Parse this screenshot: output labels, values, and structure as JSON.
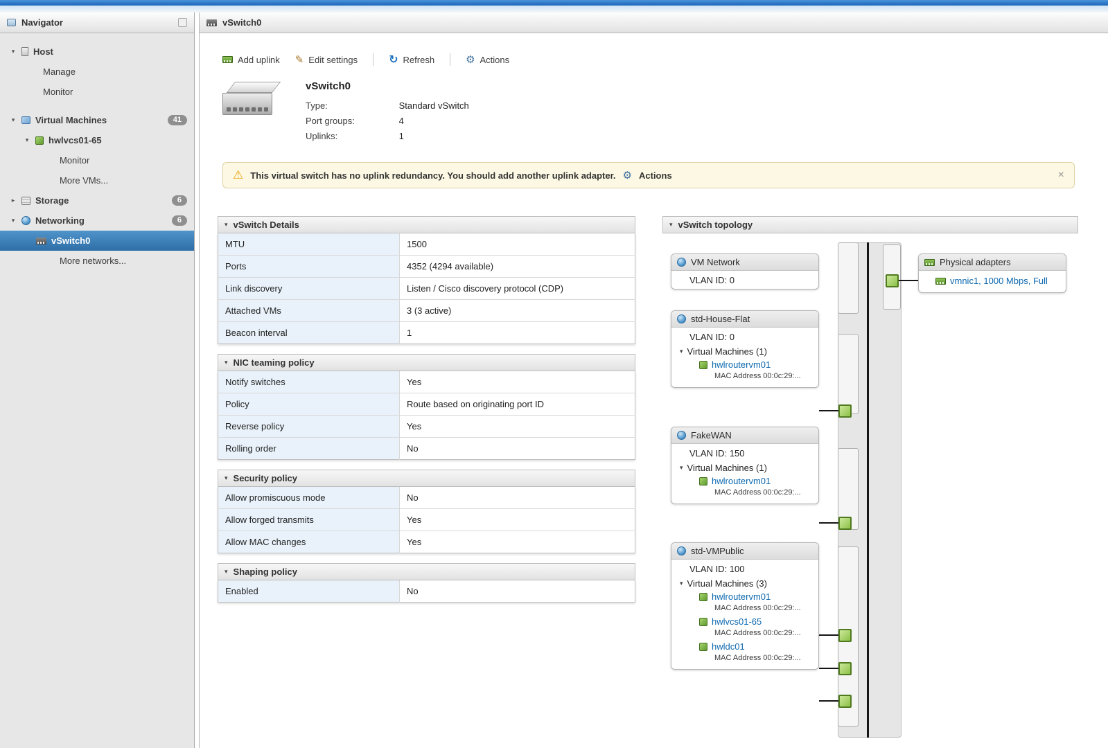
{
  "theme": {
    "topbar_blue": "#2374c8",
    "selection_blue": "#3377ad",
    "link_blue": "#0e69b0",
    "warning_bg": "#fcf8e3",
    "port_green": "#8cc148",
    "label_cell_blue": "#e9f2fa"
  },
  "navigator": {
    "title": "Navigator",
    "items": [
      {
        "label": "Host"
      },
      {
        "label": "Manage"
      },
      {
        "label": "Monitor"
      },
      {
        "label": "Virtual Machines",
        "badge": "41"
      },
      {
        "label": "hwlvcs01-65"
      },
      {
        "label": "Monitor"
      },
      {
        "label": "More VMs..."
      },
      {
        "label": "Storage",
        "badge": "6"
      },
      {
        "label": "Networking",
        "badge": "6"
      },
      {
        "label": "vSwitch0"
      },
      {
        "label": "More networks..."
      }
    ]
  },
  "main": {
    "title": "vSwitch0",
    "toolbar": {
      "add_uplink": "Add uplink",
      "edit_settings": "Edit settings",
      "refresh": "Refresh",
      "actions": "Actions"
    },
    "summary": {
      "name": "vSwitch0",
      "rows": [
        {
          "label": "Type:",
          "value": "Standard vSwitch"
        },
        {
          "label": "Port groups:",
          "value": "4"
        },
        {
          "label": "Uplinks:",
          "value": "1"
        }
      ]
    },
    "warning": {
      "text": "This virtual switch has no uplink redundancy. You should add another uplink adapter.",
      "action": "Actions",
      "close": "×"
    },
    "panels": [
      {
        "title": "vSwitch Details",
        "rows": [
          {
            "label": "MTU",
            "value": "1500"
          },
          {
            "label": "Ports",
            "value": "4352 (4294 available)"
          },
          {
            "label": "Link discovery",
            "value": "Listen / Cisco discovery protocol (CDP)"
          },
          {
            "label": "Attached VMs",
            "value": "3 (3 active)"
          },
          {
            "label": "Beacon interval",
            "value": "1"
          }
        ]
      },
      {
        "title": "NIC teaming policy",
        "rows": [
          {
            "label": "Notify switches",
            "value": "Yes"
          },
          {
            "label": "Policy",
            "value": "Route based on originating port ID"
          },
          {
            "label": "Reverse policy",
            "value": "Yes"
          },
          {
            "label": "Rolling order",
            "value": "No"
          }
        ]
      },
      {
        "title": "Security policy",
        "rows": [
          {
            "label": "Allow promiscuous mode",
            "value": "No"
          },
          {
            "label": "Allow forged transmits",
            "value": "Yes"
          },
          {
            "label": "Allow MAC changes",
            "value": "Yes"
          }
        ]
      },
      {
        "title": "Shaping policy",
        "rows": [
          {
            "label": "Enabled",
            "value": "No"
          }
        ]
      }
    ],
    "topology": {
      "title": "vSwitch topology",
      "port_groups": [
        {
          "name": "VM Network",
          "vlan": "VLAN ID: 0"
        },
        {
          "name": "std-House-Flat",
          "vlan": "VLAN ID: 0",
          "vms_label": "Virtual Machines (1)",
          "vms": [
            {
              "name": "hwlroutervm01",
              "mac": "MAC Address 00:0c:29:..."
            }
          ]
        },
        {
          "name": "FakeWAN",
          "vlan": "VLAN ID: 150",
          "vms_label": "Virtual Machines (1)",
          "vms": [
            {
              "name": "hwlroutervm01",
              "mac": "MAC Address 00:0c:29:..."
            }
          ]
        },
        {
          "name": "std-VMPublic",
          "vlan": "VLAN ID: 100",
          "vms_label": "Virtual Machines (3)",
          "vms": [
            {
              "name": "hwlroutervm01",
              "mac": "MAC Address 00:0c:29:..."
            },
            {
              "name": "hwlvcs01-65",
              "mac": "MAC Address 00:0c:29:..."
            },
            {
              "name": "hwldc01",
              "mac": "MAC Address 00:0c:29:..."
            }
          ]
        }
      ],
      "physical_adapters": {
        "title": "Physical adapters",
        "adapters": [
          {
            "label": "vmnic1, 1000 Mbps, Full"
          }
        ]
      }
    }
  }
}
